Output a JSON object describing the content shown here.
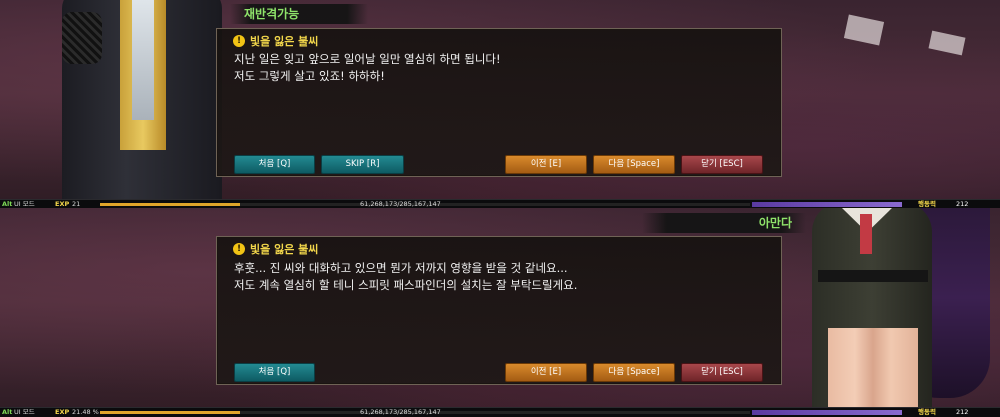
{
  "top_panel": {
    "speaker_name": "재반격가능",
    "subtitle": "빛을 잃은 불씨",
    "lines": [
      "지난 일은 잊고 앞으로 일어날 일만 열심히 하면 됩니다!",
      "저도 그렇게 살고 있죠! 하하하!"
    ],
    "buttons": {
      "first": "처음 [Q]",
      "skip": "SKIP [R]",
      "prev": "이전 [E]",
      "next": "다음 [Space]",
      "close": "닫기 [ESC]"
    }
  },
  "bottom_panel": {
    "speaker_name": "아만다",
    "subtitle": "빛을 잃은 불씨",
    "lines": [
      "후훗... 진 씨와 대화하고 있으면 뭔가 저까지 영향을 받을 것 같네요...",
      "저도 계속 열심히 할 테니 스피릿 패스파인더의 설치는 잘 부탁드릴게요."
    ],
    "buttons": {
      "first": "처음 [Q]",
      "prev": "이전 [E]",
      "next": "다음 [Space]",
      "close": "닫기 [ESC]"
    }
  },
  "status_top": {
    "alt": "Alt",
    "ui_mode": "UI 모드",
    "exp_label": "EXP",
    "exp_percent": "21",
    "exp_fraction": 0.2148,
    "exp_total": "61,268,173/285,167,147",
    "ap_label": "행동력",
    "ap_value": "212"
  },
  "status_bottom": {
    "alt": "Alt",
    "ui_mode": "UI 모드",
    "exp_label": "EXP",
    "exp_percent": "21.48 %",
    "exp_fraction": 0.2148,
    "exp_total": "61,268,173/285,167,147",
    "ap_label": "행동력",
    "ap_value": "212"
  },
  "icons": {
    "warning": "exclamation-circle-icon"
  },
  "colors": {
    "speaker_subtitle": "#f2d64b",
    "name_tag": "#8fe36a",
    "teal_button": "#238a92",
    "orange_button": "#d98a2c",
    "red_button": "#a8474b"
  }
}
